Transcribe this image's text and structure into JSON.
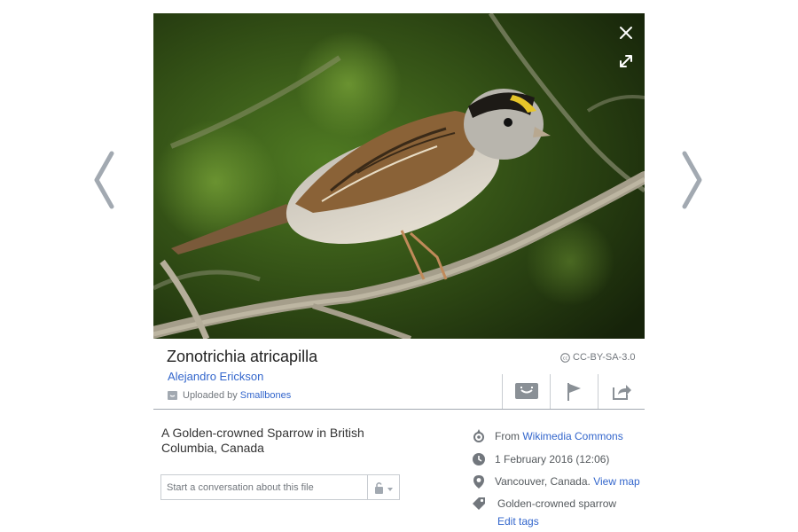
{
  "image": {
    "title": "Zonotrichia atricapilla",
    "author": "Alejandro Erickson",
    "uploaded_by_label": "Uploaded by",
    "uploader": "Smallbones",
    "license": "CC-BY-SA-3.0",
    "description": "A Golden-crowned Sparrow in British Columbia, Canada"
  },
  "icons": {
    "prev": "chevron-left-icon",
    "next": "chevron-right-icon",
    "close": "close-icon",
    "fullscreen": "fullscreen-icon",
    "reuse": "reuse-icon",
    "flag": "flag-icon",
    "share": "share-icon"
  },
  "conversation": {
    "placeholder": "Start a conversation about this file"
  },
  "meta": {
    "source_prefix": "From",
    "source_link": "Wikimedia Commons",
    "date": "1 February 2016 (12:06)",
    "location": "Vancouver, Canada.",
    "view_map": "View map",
    "tags": "Golden-crowned sparrow",
    "edit_tags": "Edit tags"
  },
  "colors": {
    "link": "#3366cc",
    "icon": "#8a9096",
    "divider": "#a2a9b1"
  }
}
